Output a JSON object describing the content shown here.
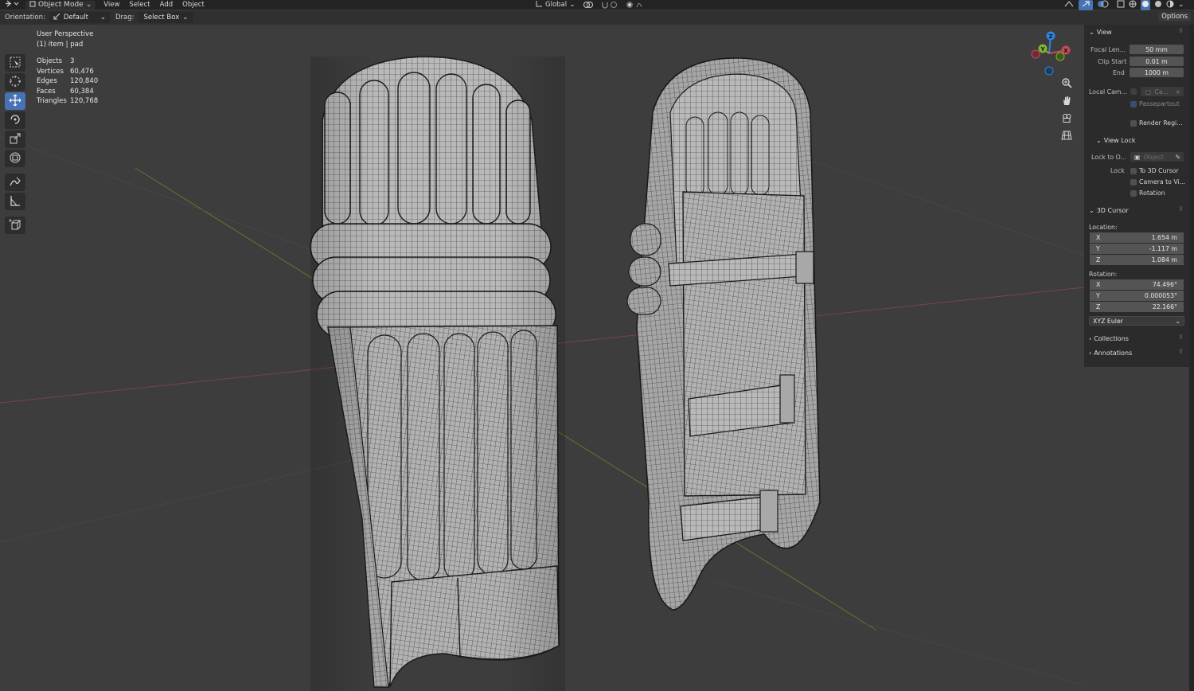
{
  "topbar": {
    "mode": "Object Mode",
    "menus": [
      "View",
      "Select",
      "Add",
      "Object"
    ],
    "transform_orientation": "Global"
  },
  "header": {
    "orientation_label": "Orientation:",
    "orientation_value": "Default",
    "drag_label": "Drag:",
    "drag_value": "Select Box",
    "options_label": "Options"
  },
  "overlay": {
    "view_name": "User Perspective",
    "object_info": "(1) item | pad",
    "stats": [
      {
        "label": "Objects",
        "value": "3"
      },
      {
        "label": "Vertices",
        "value": "60,476"
      },
      {
        "label": "Edges",
        "value": "120,840"
      },
      {
        "label": "Faces",
        "value": "60,384"
      },
      {
        "label": "Triangles",
        "value": "120,768"
      }
    ]
  },
  "gizmo": {
    "z": "Z",
    "y": "Y",
    "x": "X"
  },
  "npanel": {
    "view": {
      "title": "View",
      "focal_label": "Focal Len...",
      "focal_value": "50 mm",
      "clip_start_label": "Clip Start",
      "clip_start_value": "0.01 m",
      "end_label": "End",
      "end_value": "1000 m",
      "local_cam_label": "Local Cam...",
      "local_cam_value": "Ca...",
      "passepartout_label": "Passepartout",
      "render_region_label": "Render Regi..."
    },
    "view_lock": {
      "title": "View Lock",
      "lock_to_label": "Lock to O...",
      "lock_to_placeholder": "Object",
      "lock_label": "Lock",
      "to_3d_cursor": "To 3D Cursor",
      "camera_to_view": "Camera to Vi...",
      "rotation": "Rotation"
    },
    "cursor": {
      "title": "3D Cursor",
      "location_label": "Location:",
      "location": [
        {
          "axis": "X",
          "value": "1.654 m"
        },
        {
          "axis": "Y",
          "value": "-1.117 m"
        },
        {
          "axis": "Z",
          "value": "1.084 m"
        }
      ],
      "rotation_label": "Rotation:",
      "rotation": [
        {
          "axis": "X",
          "value": "74.496°"
        },
        {
          "axis": "Y",
          "value": "0.000053°"
        },
        {
          "axis": "Z",
          "value": "22.166°"
        }
      ],
      "rotation_mode": "XYZ Euler"
    },
    "collections_title": "Collections",
    "annotations_title": "Annotations"
  },
  "colors": {
    "viewport_bg": "#3d3d3d",
    "panel_bg": "#2b2b2b",
    "accent": "#4772b3",
    "axis_x": "#c44b57",
    "axis_y": "#83b431",
    "axis_z": "#2f83e2"
  }
}
